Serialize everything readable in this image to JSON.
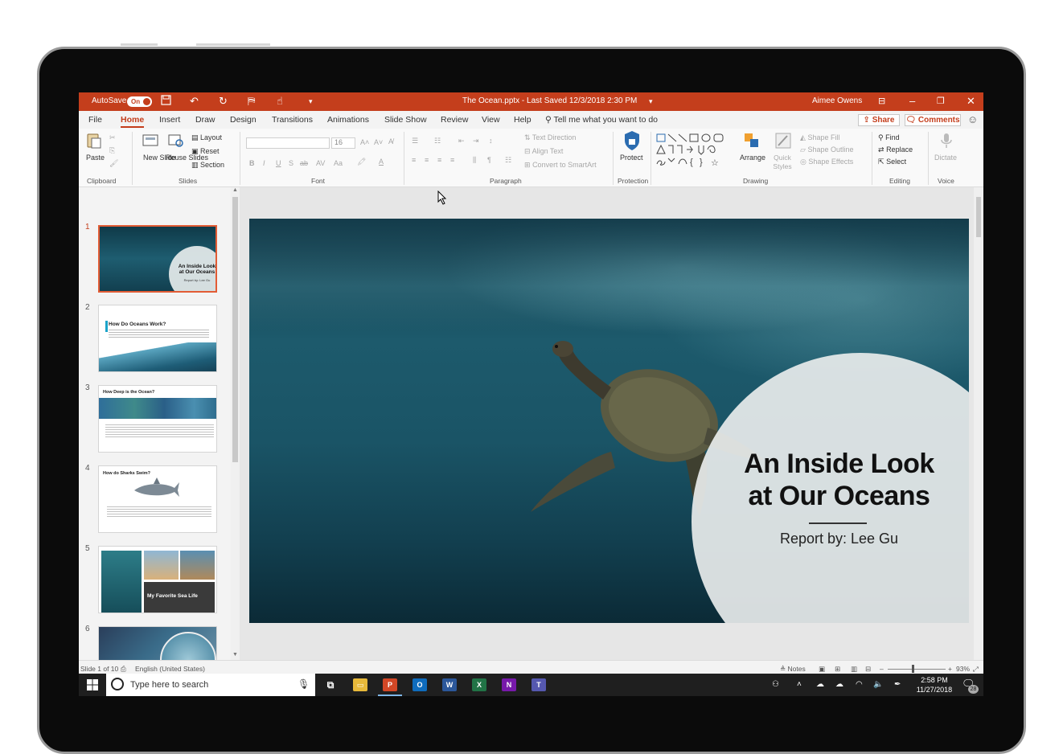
{
  "titlebar": {
    "autosave_label": "AutoSave",
    "autosave_state": "On",
    "doc_title": "The Ocean.pptx  -  Last Saved  12/3/2018  2:30 PM",
    "user": "Aimee Owens"
  },
  "tabs": [
    "File",
    "Home",
    "Insert",
    "Draw",
    "Design",
    "Transitions",
    "Animations",
    "Slide Show",
    "Review",
    "View",
    "Help"
  ],
  "tell_me": "Tell me what you want to do",
  "share_label": "Share",
  "comments_label": "Comments",
  "ribbon": {
    "paste": "Paste",
    "new_slide": "New Slide",
    "reuse_slides": "Reuse Slides",
    "layout": "Layout",
    "reset": "Reset",
    "section": "Section",
    "font_size": "16",
    "text_direction": "Text Direction",
    "align_text": "Align Text",
    "convert_smartart": "Convert to SmartArt",
    "protect": "Protect",
    "arrange": "Arrange",
    "quick_styles": "Quick Styles",
    "shape_fill": "Shape Fill",
    "shape_outline": "Shape Outline",
    "shape_effects": "Shape Effects",
    "find": "Find",
    "replace": "Replace",
    "select": "Select",
    "dictate": "Dictate",
    "groups": {
      "clipboard": "Clipboard",
      "slides": "Slides",
      "font": "Font",
      "paragraph": "Paragraph",
      "protection": "Protection",
      "drawing": "Drawing",
      "editing": "Editing",
      "voice": "Voice"
    }
  },
  "thumbnails": [
    {
      "num": "1",
      "title": "An Inside Look at Our Oceans",
      "sub": "Report by: Lee Gu"
    },
    {
      "num": "2",
      "title": "How Do Oceans Work?"
    },
    {
      "num": "3",
      "title": "How Deep is the Ocean?"
    },
    {
      "num": "4",
      "title": "How do Sharks Swim?"
    },
    {
      "num": "5",
      "title": "My Favorite Sea Life"
    },
    {
      "num": "6",
      "title": ""
    }
  ],
  "slide": {
    "title_line1": "An Inside Look",
    "title_line2": "at Our Oceans",
    "subtitle": "Report by: Lee Gu"
  },
  "status": {
    "slide_of": "Slide 1 of 10",
    "language": "English (United States)",
    "notes": "Notes",
    "zoom": "93%"
  },
  "taskbar": {
    "search_placeholder": "Type here to search",
    "time": "2:58 PM",
    "date": "11/27/2018",
    "notif_count": "28"
  },
  "colors": {
    "accent": "#c43e1c",
    "selection": "#e25c35"
  }
}
